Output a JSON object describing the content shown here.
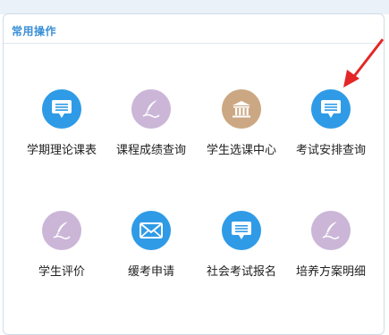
{
  "panel": {
    "title": "常用操作"
  },
  "colors": {
    "blue_icon": "#2f9be6",
    "purple_icon": "#cbb6d8",
    "tan_icon": "#cba883",
    "title": "#3a8fd6",
    "arrow": "#e42626"
  },
  "items": [
    {
      "label": "学期理论课表",
      "icon": "message-icon",
      "color": "#2f9be6"
    },
    {
      "label": "课程成绩查询",
      "icon": "quill-icon",
      "color": "#cbb6d8"
    },
    {
      "label": "学生选课中心",
      "icon": "building-icon",
      "color": "#cba883"
    },
    {
      "label": "考试安排查询",
      "icon": "message-icon",
      "color": "#2f9be6"
    },
    {
      "label": "学生评价",
      "icon": "quill-icon",
      "color": "#cbb6d8"
    },
    {
      "label": "缓考申请",
      "icon": "envelope-icon",
      "color": "#2f9be6"
    },
    {
      "label": "社会考试报名",
      "icon": "message-icon",
      "color": "#2f9be6"
    },
    {
      "label": "培养方案明细",
      "icon": "quill-icon",
      "color": "#cbb6d8"
    }
  ]
}
